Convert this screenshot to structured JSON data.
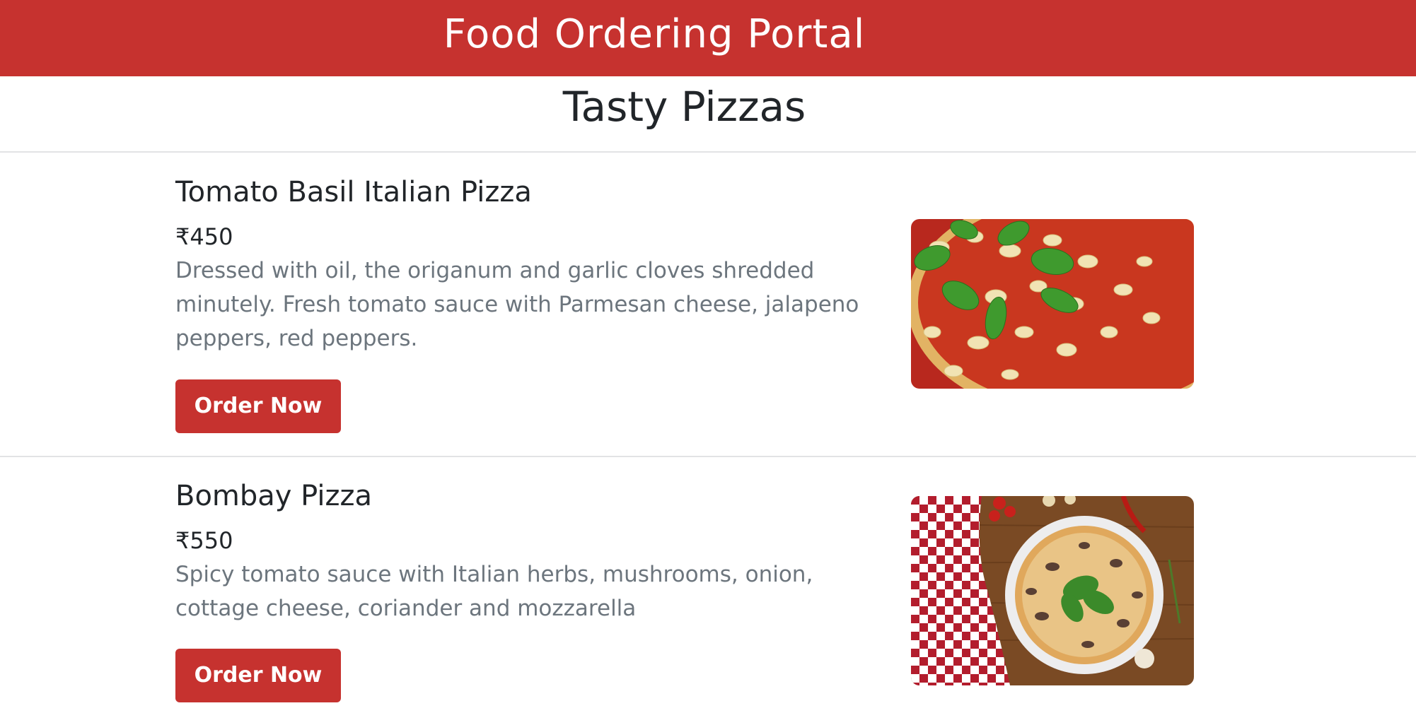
{
  "header": {
    "title": "Food Ordering Portal"
  },
  "section": {
    "title": "Tasty Pizzas"
  },
  "items": [
    {
      "name": "Tomato Basil Italian Pizza",
      "price": "₹450",
      "description": "Dressed with oil, the origanum and garlic cloves shredded minutely. Fresh tomato sauce with Parmesan cheese, jalapeno peppers, red peppers.",
      "button_label": "Order Now",
      "image": "tomato-basil-pizza-photo"
    },
    {
      "name": "Bombay Pizza",
      "price": "₹550",
      "description": "Spicy tomato sauce with Italian herbs, mushrooms, onion, cottage cheese, coriander and mozzarella",
      "button_label": "Order Now",
      "image": "bombay-pizza-photo"
    }
  ],
  "colors": {
    "brand": "#c6322f",
    "text": "#212529",
    "muted": "#6c757d"
  }
}
